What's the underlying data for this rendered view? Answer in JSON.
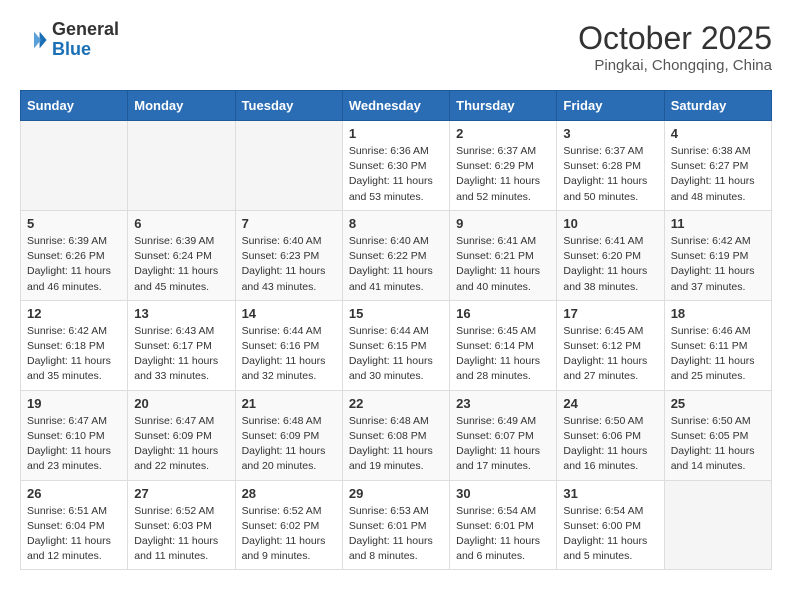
{
  "header": {
    "logo": {
      "general": "General",
      "blue": "Blue"
    },
    "title": "October 2025",
    "location": "Pingkai, Chongqing, China"
  },
  "weekdays": [
    "Sunday",
    "Monday",
    "Tuesday",
    "Wednesday",
    "Thursday",
    "Friday",
    "Saturday"
  ],
  "weeks": [
    [
      {
        "day": "",
        "info": ""
      },
      {
        "day": "",
        "info": ""
      },
      {
        "day": "",
        "info": ""
      },
      {
        "day": "1",
        "info": "Sunrise: 6:36 AM\nSunset: 6:30 PM\nDaylight: 11 hours\nand 53 minutes."
      },
      {
        "day": "2",
        "info": "Sunrise: 6:37 AM\nSunset: 6:29 PM\nDaylight: 11 hours\nand 52 minutes."
      },
      {
        "day": "3",
        "info": "Sunrise: 6:37 AM\nSunset: 6:28 PM\nDaylight: 11 hours\nand 50 minutes."
      },
      {
        "day": "4",
        "info": "Sunrise: 6:38 AM\nSunset: 6:27 PM\nDaylight: 11 hours\nand 48 minutes."
      }
    ],
    [
      {
        "day": "5",
        "info": "Sunrise: 6:39 AM\nSunset: 6:26 PM\nDaylight: 11 hours\nand 46 minutes."
      },
      {
        "day": "6",
        "info": "Sunrise: 6:39 AM\nSunset: 6:24 PM\nDaylight: 11 hours\nand 45 minutes."
      },
      {
        "day": "7",
        "info": "Sunrise: 6:40 AM\nSunset: 6:23 PM\nDaylight: 11 hours\nand 43 minutes."
      },
      {
        "day": "8",
        "info": "Sunrise: 6:40 AM\nSunset: 6:22 PM\nDaylight: 11 hours\nand 41 minutes."
      },
      {
        "day": "9",
        "info": "Sunrise: 6:41 AM\nSunset: 6:21 PM\nDaylight: 11 hours\nand 40 minutes."
      },
      {
        "day": "10",
        "info": "Sunrise: 6:41 AM\nSunset: 6:20 PM\nDaylight: 11 hours\nand 38 minutes."
      },
      {
        "day": "11",
        "info": "Sunrise: 6:42 AM\nSunset: 6:19 PM\nDaylight: 11 hours\nand 37 minutes."
      }
    ],
    [
      {
        "day": "12",
        "info": "Sunrise: 6:42 AM\nSunset: 6:18 PM\nDaylight: 11 hours\nand 35 minutes."
      },
      {
        "day": "13",
        "info": "Sunrise: 6:43 AM\nSunset: 6:17 PM\nDaylight: 11 hours\nand 33 minutes."
      },
      {
        "day": "14",
        "info": "Sunrise: 6:44 AM\nSunset: 6:16 PM\nDaylight: 11 hours\nand 32 minutes."
      },
      {
        "day": "15",
        "info": "Sunrise: 6:44 AM\nSunset: 6:15 PM\nDaylight: 11 hours\nand 30 minutes."
      },
      {
        "day": "16",
        "info": "Sunrise: 6:45 AM\nSunset: 6:14 PM\nDaylight: 11 hours\nand 28 minutes."
      },
      {
        "day": "17",
        "info": "Sunrise: 6:45 AM\nSunset: 6:12 PM\nDaylight: 11 hours\nand 27 minutes."
      },
      {
        "day": "18",
        "info": "Sunrise: 6:46 AM\nSunset: 6:11 PM\nDaylight: 11 hours\nand 25 minutes."
      }
    ],
    [
      {
        "day": "19",
        "info": "Sunrise: 6:47 AM\nSunset: 6:10 PM\nDaylight: 11 hours\nand 23 minutes."
      },
      {
        "day": "20",
        "info": "Sunrise: 6:47 AM\nSunset: 6:09 PM\nDaylight: 11 hours\nand 22 minutes."
      },
      {
        "day": "21",
        "info": "Sunrise: 6:48 AM\nSunset: 6:09 PM\nDaylight: 11 hours\nand 20 minutes."
      },
      {
        "day": "22",
        "info": "Sunrise: 6:48 AM\nSunset: 6:08 PM\nDaylight: 11 hours\nand 19 minutes."
      },
      {
        "day": "23",
        "info": "Sunrise: 6:49 AM\nSunset: 6:07 PM\nDaylight: 11 hours\nand 17 minutes."
      },
      {
        "day": "24",
        "info": "Sunrise: 6:50 AM\nSunset: 6:06 PM\nDaylight: 11 hours\nand 16 minutes."
      },
      {
        "day": "25",
        "info": "Sunrise: 6:50 AM\nSunset: 6:05 PM\nDaylight: 11 hours\nand 14 minutes."
      }
    ],
    [
      {
        "day": "26",
        "info": "Sunrise: 6:51 AM\nSunset: 6:04 PM\nDaylight: 11 hours\nand 12 minutes."
      },
      {
        "day": "27",
        "info": "Sunrise: 6:52 AM\nSunset: 6:03 PM\nDaylight: 11 hours\nand 11 minutes."
      },
      {
        "day": "28",
        "info": "Sunrise: 6:52 AM\nSunset: 6:02 PM\nDaylight: 11 hours\nand 9 minutes."
      },
      {
        "day": "29",
        "info": "Sunrise: 6:53 AM\nSunset: 6:01 PM\nDaylight: 11 hours\nand 8 minutes."
      },
      {
        "day": "30",
        "info": "Sunrise: 6:54 AM\nSunset: 6:01 PM\nDaylight: 11 hours\nand 6 minutes."
      },
      {
        "day": "31",
        "info": "Sunrise: 6:54 AM\nSunset: 6:00 PM\nDaylight: 11 hours\nand 5 minutes."
      },
      {
        "day": "",
        "info": ""
      }
    ]
  ]
}
